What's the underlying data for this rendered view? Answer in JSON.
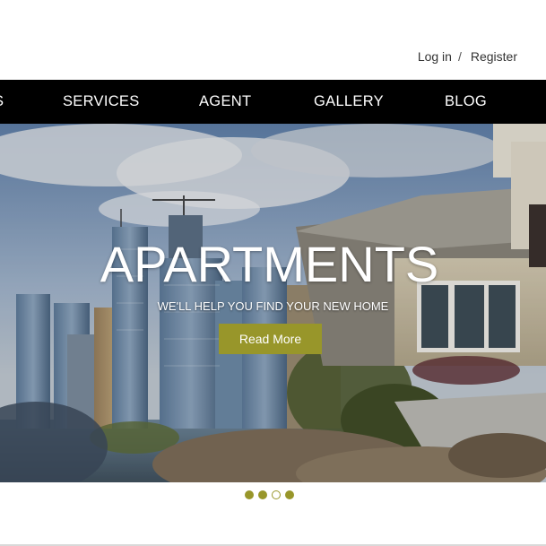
{
  "auth": {
    "login": "Log in",
    "separator": "/",
    "register": "Register"
  },
  "nav": {
    "items": [
      {
        "label": "S"
      },
      {
        "label": "SERVICES"
      },
      {
        "label": "AGENT"
      },
      {
        "label": "GALLERY"
      },
      {
        "label": "BLOG"
      }
    ]
  },
  "hero": {
    "title": "APARTMENTS",
    "subtitle": "WE'LL HELP YOU FIND YOUR NEW HOME",
    "button_label": "Read More"
  },
  "slider": {
    "dot_count": 4,
    "active_index": 2
  },
  "colors": {
    "accent": "#98962a",
    "nav_bg": "#000000",
    "nav_text": "#ffffff"
  }
}
